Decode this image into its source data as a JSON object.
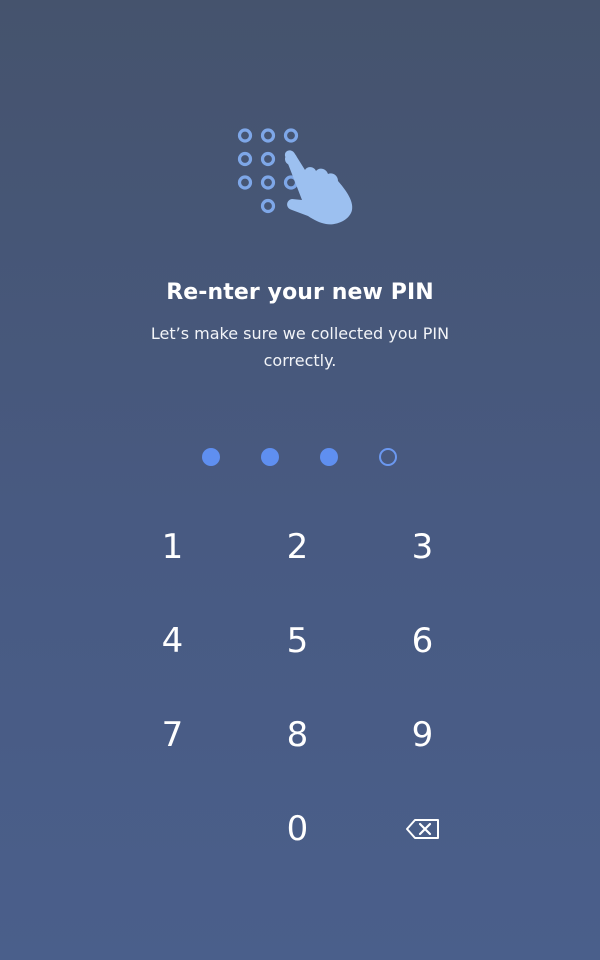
{
  "screen": {
    "title": "Re-nter your new PIN",
    "subtitle": "Let’s make sure we collected you PIN correctly."
  },
  "illustration": {
    "icon": "keypad-tap-icon",
    "colors": {
      "keypad": "#7ea7e8",
      "hand": "#9cc0f0"
    }
  },
  "pin": {
    "length": 4,
    "entered": 3,
    "filled_color": "#5f8ff0",
    "empty_color": "#6b98f0"
  },
  "keypad": {
    "keys": [
      "1",
      "2",
      "3",
      "4",
      "5",
      "6",
      "7",
      "8",
      "9",
      "0"
    ],
    "backspace_icon": "backspace-icon"
  },
  "colors": {
    "background_top": "#45536d",
    "background_bottom": "#4a5f8b",
    "text": "#ffffff"
  }
}
